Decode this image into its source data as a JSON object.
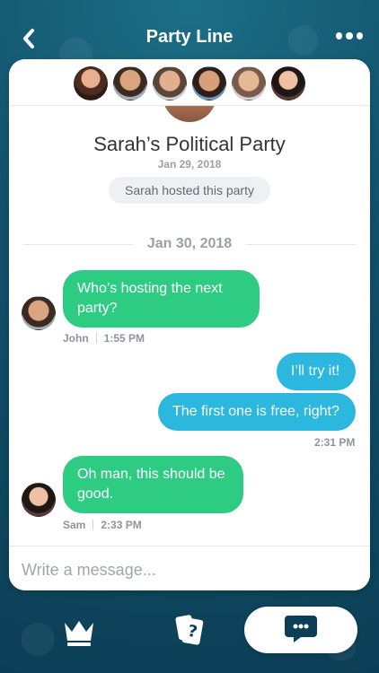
{
  "header": {
    "title": "Party Line",
    "back_icon": "back-chevron-icon",
    "more_icon": "more-dots-icon"
  },
  "participants": [
    {
      "name": "avatar-1"
    },
    {
      "name": "avatar-2"
    },
    {
      "name": "avatar-3"
    },
    {
      "name": "avatar-4"
    },
    {
      "name": "avatar-5"
    },
    {
      "name": "avatar-6"
    }
  ],
  "party": {
    "title": "Sarah’s Political Party",
    "date": "Jan 29, 2018",
    "host_text": "Sarah hosted this party"
  },
  "conversation": {
    "date_separator": "Jan 30, 2018",
    "messages": [
      {
        "direction": "in",
        "text": "Who’s hosting the next party?",
        "sender": "John",
        "time": "1:55 PM"
      },
      {
        "direction": "out",
        "text": "I’ll try it!"
      },
      {
        "direction": "out",
        "text": "The first one is free, right?",
        "time": "2:31 PM"
      },
      {
        "direction": "in",
        "text": "Oh man, this should be good.",
        "sender": "Sam",
        "time": "2:33 PM"
      }
    ]
  },
  "composer": {
    "placeholder": "Write a message..."
  },
  "bottom_nav": {
    "items": [
      {
        "icon": "crown-icon"
      },
      {
        "icon": "cards-question-icon"
      },
      {
        "icon": "chat-bubble-icon",
        "active": true
      }
    ]
  },
  "colors": {
    "incoming_bubble": "#2ecc83",
    "outgoing_bubble": "#2bb7de",
    "accent_dark": "#0c3f57"
  }
}
